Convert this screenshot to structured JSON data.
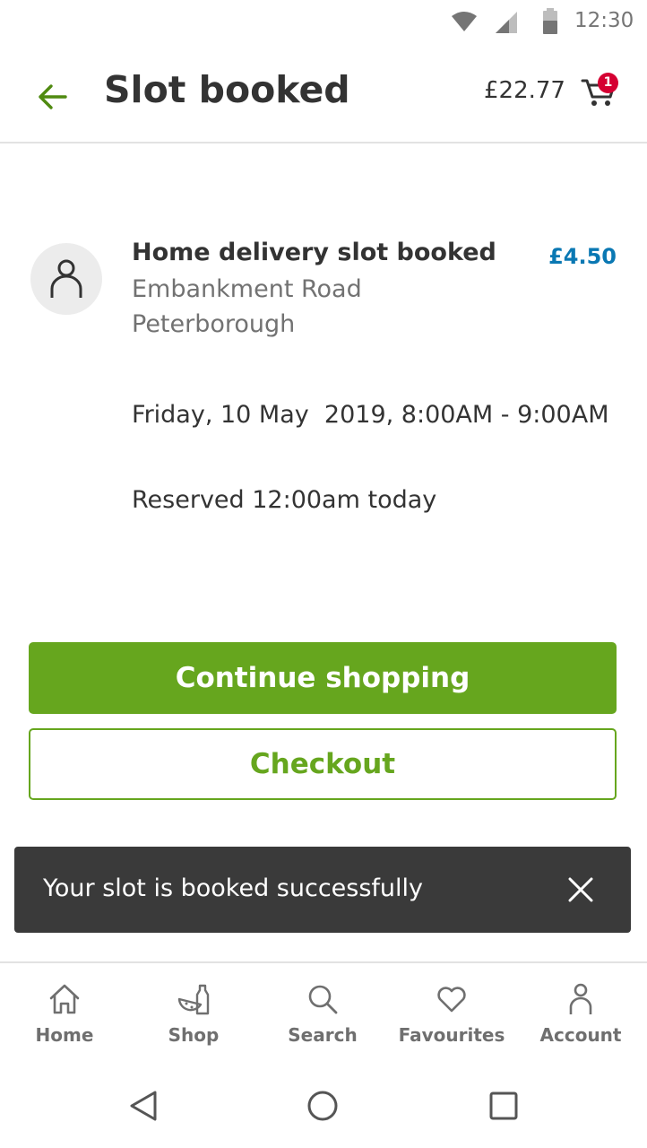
{
  "status_bar": {
    "time": "12:30"
  },
  "header": {
    "title": "Slot booked",
    "basket_total": "£22.77",
    "cart_count": "1"
  },
  "slot": {
    "title": "Home delivery slot booked",
    "price": "£4.50",
    "address_line1": "Embankment Road",
    "address_line2": "Peterborough",
    "date": "Friday, 10 May  2019, 8:00AM - 9:00AM",
    "reserved": "Reserved 12:00am today"
  },
  "actions": {
    "continue_label": "Continue shopping",
    "checkout_label": "Checkout"
  },
  "snackbar": {
    "message": "Your slot is booked successfully"
  },
  "bottom_nav": {
    "items": [
      {
        "label": "Home",
        "icon": "home-icon"
      },
      {
        "label": "Shop",
        "icon": "shop-icon"
      },
      {
        "label": "Search",
        "icon": "search-icon"
      },
      {
        "label": "Favourites",
        "icon": "heart-icon"
      },
      {
        "label": "Account",
        "icon": "account-icon"
      }
    ]
  },
  "colors": {
    "brand_green": "#66a61e",
    "price_blue": "#0a78b3",
    "badge_red": "#d50032",
    "snackbar_bg": "#3a3a3a"
  }
}
